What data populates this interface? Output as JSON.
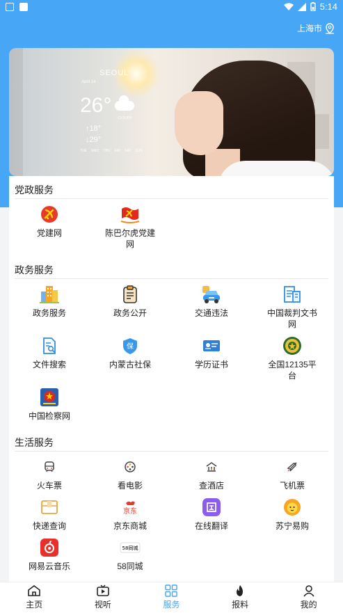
{
  "status": {
    "time": "5:14"
  },
  "location": {
    "city": "上海市"
  },
  "banner": {
    "city": "SEOUL",
    "date": "April 14",
    "temp": "26°",
    "condition": "CLOUDY",
    "high": "↑18°",
    "low": "↓29°",
    "days": [
      "TUE",
      "WED",
      "THU",
      "FRI",
      "SAT",
      "SUN"
    ]
  },
  "sections": [
    {
      "title": "党政服务",
      "items": [
        {
          "label": "党建网",
          "icon": "party-emblem-icon"
        },
        {
          "label": "陈巴尔虎党建网",
          "icon": "party-flag-emblem-icon"
        }
      ]
    },
    {
      "title": "政务服务",
      "items": [
        {
          "label": "政务服务",
          "icon": "buildings-icon"
        },
        {
          "label": "政务公开",
          "icon": "clipboard-icon"
        },
        {
          "label": "交通违法",
          "icon": "car-icon"
        },
        {
          "label": "中国裁判文书网",
          "icon": "document-building-icon"
        },
        {
          "label": "文件搜索",
          "icon": "file-search-icon"
        },
        {
          "label": "内蒙古社保",
          "icon": "social-security-shield-icon"
        },
        {
          "label": "学历证书",
          "icon": "certificate-card-icon"
        },
        {
          "label": "全国12135平台",
          "icon": "round-seal-icon"
        },
        {
          "label": "中国检察网",
          "icon": "procuratorate-emblem-icon"
        }
      ]
    },
    {
      "title": "生活服务",
      "items": [
        {
          "label": "火车票",
          "icon": "train-icon"
        },
        {
          "label": "看电影",
          "icon": "film-reel-icon"
        },
        {
          "label": "查酒店",
          "icon": "hotel-icon"
        },
        {
          "label": "飞机票",
          "icon": "airplane-icon"
        },
        {
          "label": "快递查询",
          "icon": "package-icon"
        },
        {
          "label": "京东商城",
          "icon": "jd-logo-icon",
          "logo_text": "京东"
        },
        {
          "label": "在线翻译",
          "icon": "translate-icon"
        },
        {
          "label": "苏宁易购",
          "icon": "suning-lion-icon"
        },
        {
          "label": "网易云音乐",
          "icon": "netease-music-icon"
        },
        {
          "label": "58同城",
          "icon": "58-logo-icon",
          "logo_text": "58同城"
        }
      ]
    }
  ],
  "tabs": [
    {
      "label": "主页",
      "icon": "home-icon",
      "active": false
    },
    {
      "label": "视听",
      "icon": "tv-play-icon",
      "active": false
    },
    {
      "label": "服务",
      "icon": "grid-icon",
      "active": true
    },
    {
      "label": "报料",
      "icon": "fire-icon",
      "active": false
    },
    {
      "label": "我的",
      "icon": "user-icon",
      "active": false
    }
  ],
  "colors": {
    "primary": "#47a6f6",
    "active_tab": "#4aa3f0",
    "party_red": "#d7261e"
  }
}
